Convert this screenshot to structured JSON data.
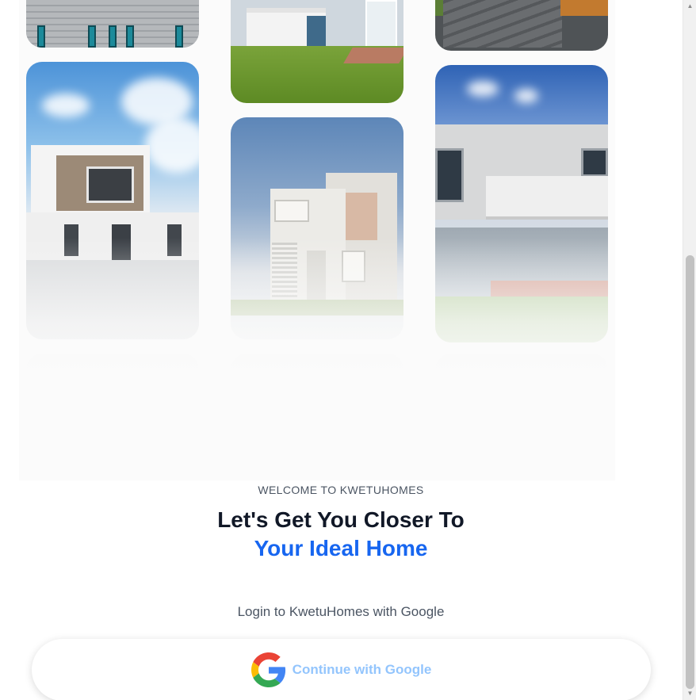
{
  "gallery": {
    "photos": [
      {
        "id": "photo-grey-siding-house"
      },
      {
        "id": "photo-modern-white-brick-house"
      },
      {
        "id": "photo-blue-porch-house"
      },
      {
        "id": "photo-cream-townhouse"
      },
      {
        "id": "photo-stone-steps-house"
      },
      {
        "id": "photo-grey-glass-house"
      }
    ]
  },
  "hero": {
    "eyebrow": "WELCOME TO KWETUHOMES",
    "headline": "Let's Get You Closer To",
    "headline_accent": "Your Ideal Home",
    "accent_color": "#1766f0"
  },
  "login": {
    "prompt": "Login to KwetuHomes with Google",
    "google_button_label": "Continue with Google",
    "google_icon": "google-g-icon"
  },
  "scrollbar": {
    "up_icon": "arrow-up-icon",
    "down_icon": "arrow-down-icon"
  }
}
